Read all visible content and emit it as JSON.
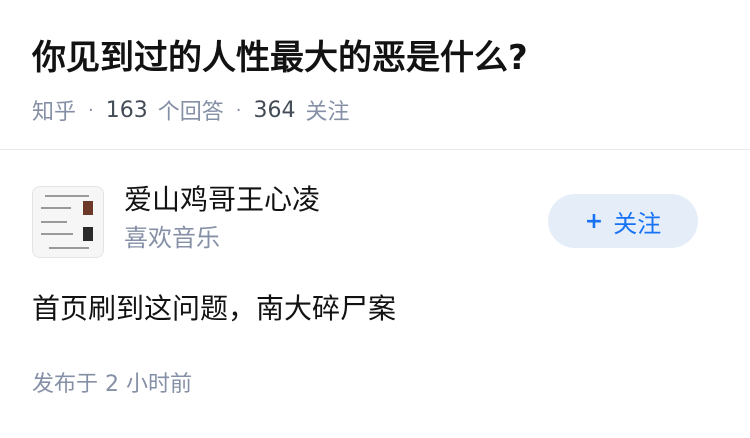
{
  "question": {
    "title": "你见到过的人性最大的恶是什么?",
    "source": "知乎",
    "answer_count": "163",
    "answer_label": "个回答",
    "follower_count": "364",
    "follower_label": "关注"
  },
  "answer": {
    "author": {
      "name": "爱山鸡哥王心凌",
      "bio": "喜欢音乐",
      "avatar_icon": "screenshot-thumbnail-avatar"
    },
    "follow_button": {
      "icon": "plus-icon",
      "label": "关注",
      "color": "#1772f6",
      "background": "#e5eef8"
    },
    "content": "首页刷到这问题，南大碎尸案",
    "published_prefix": "发布于",
    "published_time": "2 小时前"
  },
  "colors": {
    "title": "#121212",
    "meta": "#8590a6",
    "divider": "#ebebeb"
  }
}
